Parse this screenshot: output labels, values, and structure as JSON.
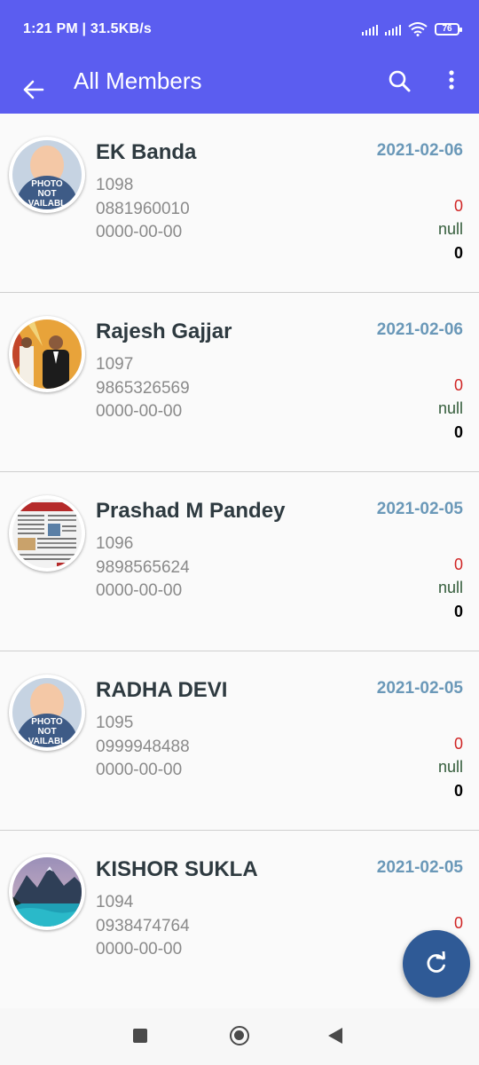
{
  "status": {
    "time": "1:21 PM | 31.5KB/s",
    "battery": "76"
  },
  "appbar": {
    "title": "All Members"
  },
  "placeholder_text": [
    "PHOTO",
    "NOT",
    "VAILABL"
  ],
  "members": [
    {
      "name": "EK Banda",
      "id": "1098",
      "phone": "0881960010",
      "date2": "0000-00-00",
      "date": "2021-02-06",
      "v1": "0",
      "v2": "null",
      "v3": "0"
    },
    {
      "name": "Rajesh Gajjar",
      "id": "1097",
      "phone": "9865326569",
      "date2": "0000-00-00",
      "date": "2021-02-06",
      "v1": "0",
      "v2": "null",
      "v3": "0"
    },
    {
      "name": "Prashad M Pandey",
      "id": "1096",
      "phone": "9898565624",
      "date2": "0000-00-00",
      "date": "2021-02-05",
      "v1": "0",
      "v2": "null",
      "v3": "0"
    },
    {
      "name": "RADHA DEVI",
      "id": "1095",
      "phone": "0999948488",
      "date2": "0000-00-00",
      "date": "2021-02-05",
      "v1": "0",
      "v2": "null",
      "v3": "0"
    },
    {
      "name": "KISHOR SUKLA",
      "id": "1094",
      "phone": "0938474764",
      "date2": "0000-00-00",
      "date": "2021-02-05",
      "v1": "0"
    }
  ],
  "icons": {
    "back": "arrow-left-icon",
    "search": "search-icon",
    "more": "more-vert-icon",
    "fab": "refresh-icon",
    "nav_recents": "square-icon",
    "nav_home": "circle-icon",
    "nav_back": "triangle-back-icon"
  },
  "colors": {
    "appbar": "#5b5df0",
    "fab": "#2f5a96",
    "date": "#6a98b8",
    "red": "#d02525",
    "green": "#335c3a"
  }
}
